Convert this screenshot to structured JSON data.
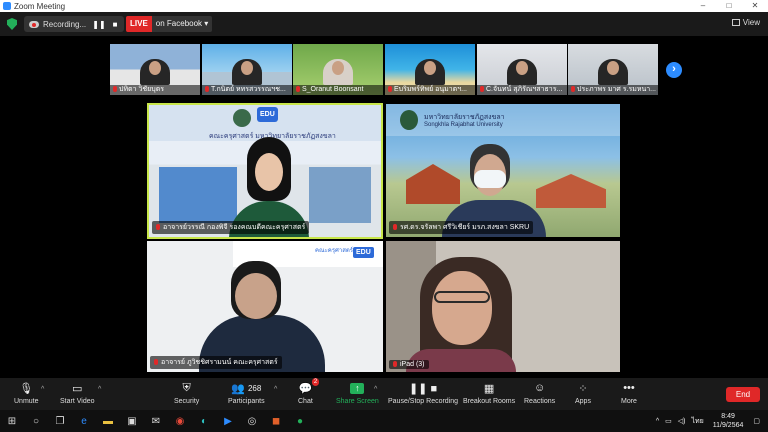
{
  "window": {
    "title": "Zoom Meeting",
    "controls": [
      "–",
      "□",
      "✕"
    ]
  },
  "topbar": {
    "recording_label": "Recording...",
    "pause_symbol": "❚❚",
    "stop_symbol": "■",
    "live_badge": "LIVE",
    "live_target": "on Facebook",
    "live_dropdown": "▾",
    "view_label": "View"
  },
  "strip": [
    {
      "name": "ปทิตา วิชัยบุตร"
    },
    {
      "name": "T.กนิตย์ หทรสวรรณฯช..."
    },
    {
      "name": "S_Oranut Boonsant"
    },
    {
      "name": "Eบริมพร์ทิพย์ อนุมาตฯ..."
    },
    {
      "name": "C.จันทน์ สุภิรัณฯสาธาร..."
    },
    {
      "name": "ประภาพร มาศ ร.รมหนา..."
    }
  ],
  "next_arrow": "›",
  "tiles": [
    {
      "name": "อาจารย์วรรณี กองพิจี รองคณบดีคณะครุศาสตร์",
      "banner": "คณะครุศาสตร์ มหาวิทยาลัยราชภัฏสงขลา",
      "logo": "EDU"
    },
    {
      "name": "รศ.ดร.จรัลพา ศรีวิเชียร์ มรภ.สงขลา SKRU",
      "banner": "มหาวิทยาลัยราชภัฏสงขลา",
      "banner_sub": "Songkhla Rajabhat University"
    },
    {
      "name": "อาจารย์ ภูวิชชิศรามนน์ คณะครุศาสตร์",
      "banner": "คณะครุศาสตร์",
      "logo": "EDU"
    },
    {
      "name": "iPad (3)"
    }
  ],
  "toolbar": {
    "unmute": "Unmute",
    "start_video": "Start Video",
    "security": "Security",
    "participants": "Participants",
    "participants_count": "268",
    "chat": "Chat",
    "chat_badge": "2",
    "share_screen": "Share Screen",
    "pause_stop_recording": "Pause/Stop Recording",
    "breakout_rooms": "Breakout Rooms",
    "reactions": "Reactions",
    "apps": "Apps",
    "more": "More",
    "end": "End"
  },
  "taskbar": {
    "lang": "ไทย",
    "time": "8:49",
    "date": "11/9/2564"
  },
  "colors": {
    "accent_blue": "#2d8cff",
    "live_red": "#e02828",
    "share_green": "#23b05a",
    "speaker_highlight": "#c8e64a"
  }
}
